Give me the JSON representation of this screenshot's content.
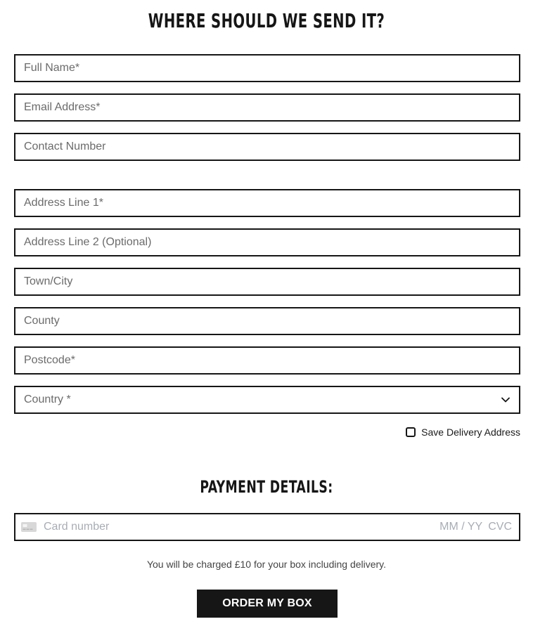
{
  "shipping": {
    "heading": "WHERE SHOULD WE SEND IT?",
    "fields": {
      "full_name": {
        "placeholder": "Full Name*",
        "value": ""
      },
      "email": {
        "placeholder": "Email Address*",
        "value": ""
      },
      "contact_number": {
        "placeholder": "Contact Number",
        "value": ""
      },
      "address_line_1": {
        "placeholder": "Address Line 1*",
        "value": ""
      },
      "address_line_2": {
        "placeholder": "Address Line 2 (Optional)",
        "value": ""
      },
      "town_city": {
        "placeholder": "Town/City",
        "value": ""
      },
      "county": {
        "placeholder": "County",
        "value": ""
      },
      "postcode": {
        "placeholder": "Postcode*",
        "value": ""
      },
      "country": {
        "selected": "Country *"
      }
    },
    "save_address_label": "Save Delivery Address",
    "save_address_checked": false
  },
  "payment": {
    "heading": "PAYMENT DETAILS:",
    "card_number_placeholder": "Card number",
    "expiry_placeholder": "MM / YY",
    "cvc_placeholder": "CVC",
    "card_icon": "credit-card-icon"
  },
  "charge_note": "You will be charged £10 for your box including delivery.",
  "order_button_label": "ORDER MY BOX",
  "colors": {
    "border": "#161616",
    "button_bg": "#161616",
    "button_text": "#ffffff",
    "placeholder": "#6b6b6b",
    "card_placeholder": "#a8adb4"
  }
}
